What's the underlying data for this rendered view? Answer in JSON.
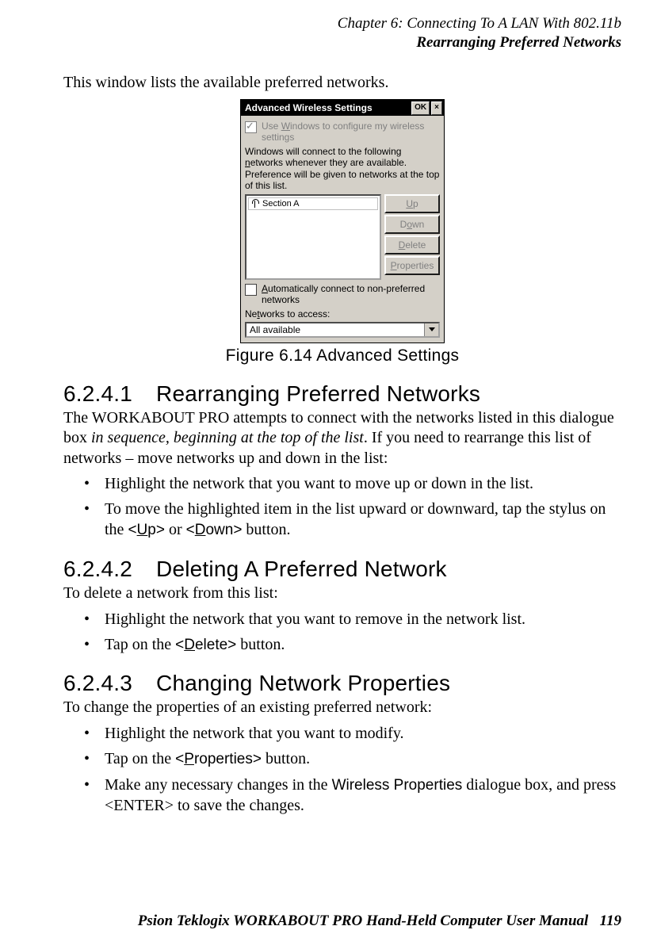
{
  "header": {
    "chapter": "Chapter 6: Connecting To A LAN With 802.11b",
    "section": "Rearranging Preferred Networks"
  },
  "intro": "This window lists the available preferred networks.",
  "dialog": {
    "title": "Advanced Wireless Settings",
    "ok": "OK",
    "close": "×",
    "use_windows_pre": "Use ",
    "use_windows_u": "W",
    "use_windows_post": "indows to configure my wireless settings",
    "desc_pre": "Windows will connect to the following ",
    "desc_u": "n",
    "desc_post": "etworks whenever they are available. Preference will be given to networks at the top of this list.",
    "list_item": "Section A",
    "btn_up_u": "U",
    "btn_up_rest": "p",
    "btn_down": "D",
    "btn_down_u": "o",
    "btn_down_rest": "wn",
    "btn_del_u": "D",
    "btn_del_rest": "elete",
    "btn_prop_u": "P",
    "btn_prop_rest": "roperties",
    "auto_u": "A",
    "auto_rest": "utomatically connect to non-preferred networks",
    "access_pre": "Ne",
    "access_u": "t",
    "access_post": "works to access:",
    "combo_value": "All available"
  },
  "caption": "Figure 6.14 Advanced Settings",
  "s1": {
    "num": "6.2.4.1",
    "title": "Rearranging Preferred Networks",
    "p_pre": "The WORKABOUT PRO attempts to connect with the networks listed in this dialogue box ",
    "p_em": "in sequence, beginning at the top of the list",
    "p_post": ". If you need to rearrange this list of networks – move networks up and down in the list:",
    "b1": "Highlight the network that you want to move up or down in the list.",
    "b2_pre": "To move the highlighted item in the list upward or downward, tap the stylus on the ",
    "b2_up_open": "<",
    "b2_up_u": "U",
    "b2_up_rest": "p>",
    "b2_mid": " or ",
    "b2_down_open": "<",
    "b2_down_u": "D",
    "b2_down_rest": "own>",
    "b2_end": " button."
  },
  "s2": {
    "num": "6.2.4.2",
    "title": "Deleting A Preferred Network",
    "p": "To delete a network from this list:",
    "b1": "Highlight the network that you want to remove in the network list.",
    "b2_pre": "Tap on the ",
    "b2_open": "<",
    "b2_u": "D",
    "b2_rest": "elete>",
    "b2_end": " button."
  },
  "s3": {
    "num": "6.2.4.3",
    "title": "Changing Network Properties",
    "p": "To change the properties of an existing preferred network:",
    "b1": "Highlight the network that you want to modify.",
    "b2_pre": "Tap on the ",
    "b2_open": "<",
    "b2_u": "P",
    "b2_rest": "roperties>",
    "b2_end": " button.",
    "b3_pre": "Make any necessary changes in the ",
    "b3_bold": "Wireless Properties",
    "b3_post": " dialogue box, and press <ENTER> to save the changes."
  },
  "footer": {
    "text": "Psion Teklogix WORKABOUT PRO Hand-Held Computer User Manual",
    "page": "119"
  }
}
